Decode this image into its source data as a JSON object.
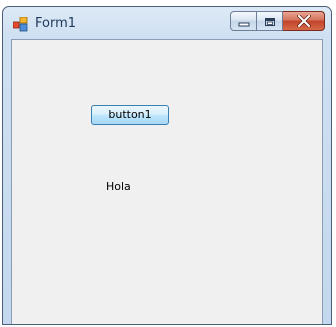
{
  "window": {
    "title": "Form1"
  },
  "caption_buttons": {
    "minimize_icon": "minimize-icon",
    "maximize_icon": "maximize-icon",
    "close_icon": "close-icon"
  },
  "form": {
    "button_label": "button1",
    "label_text": "Hola"
  },
  "colors": {
    "client_background": "#f0f0f0",
    "close_button": "#c2432a",
    "frame": "#c3d8ee"
  }
}
